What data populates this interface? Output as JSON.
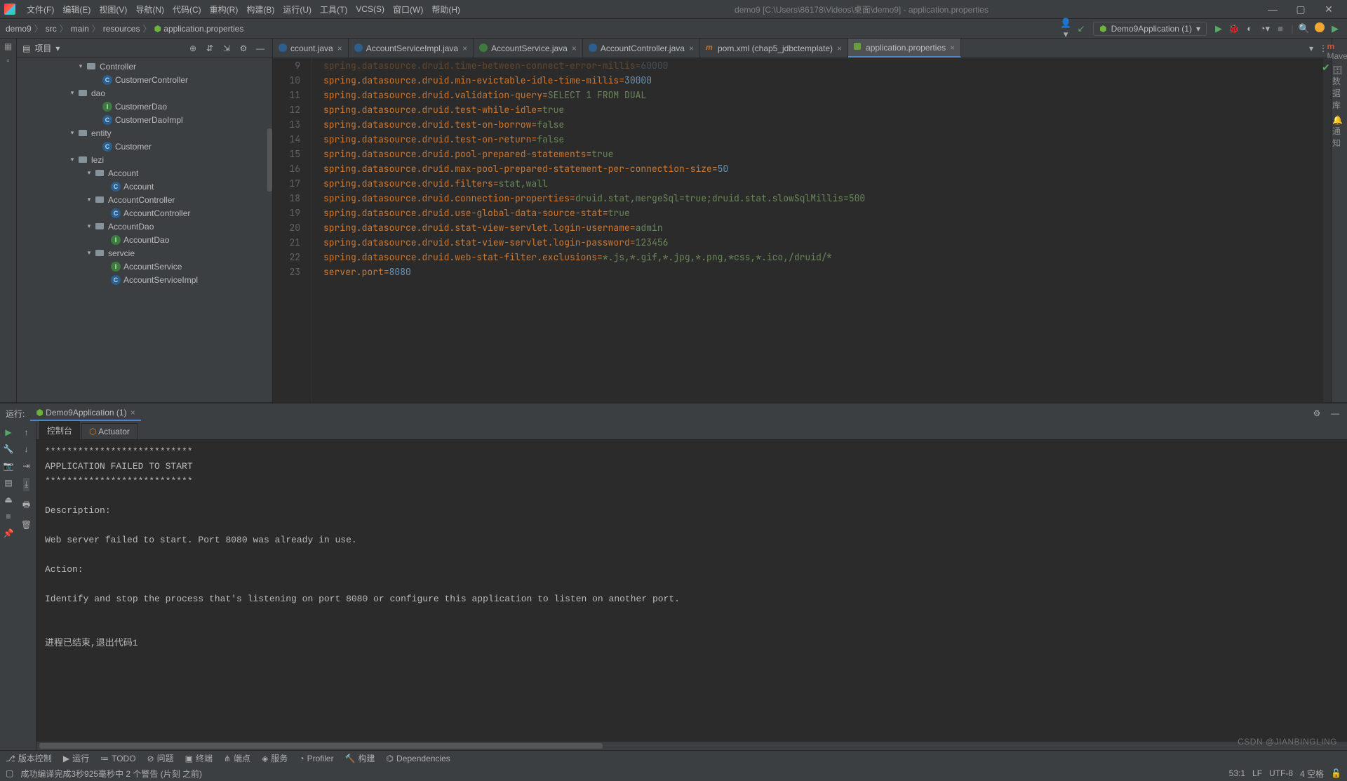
{
  "window": {
    "title": "demo9 [C:\\Users\\86178\\Videos\\桌面\\demo9] - application.properties"
  },
  "menu": {
    "file": "文件(F)",
    "edit": "编辑(E)",
    "view": "视图(V)",
    "nav": "导航(N)",
    "code": "代码(C)",
    "refactor": "重构(R)",
    "build": "构建(B)",
    "run": "运行(U)",
    "tools": "工具(T)",
    "vcs": "VCS(S)",
    "window": "窗口(W)",
    "help": "帮助(H)"
  },
  "breadcrumbs": [
    "demo9",
    "src",
    "main",
    "resources",
    "application.properties"
  ],
  "runConfig": "Demo9Application (1)",
  "projectPanel": {
    "title": "项目"
  },
  "tree": [
    {
      "indent": 7,
      "arrow": "▾",
      "icon": "pkg",
      "label": "Controller"
    },
    {
      "indent": 9,
      "arrow": "",
      "icon": "c-blue",
      "label": "CustomerController"
    },
    {
      "indent": 6,
      "arrow": "▾",
      "icon": "pkg",
      "label": "dao"
    },
    {
      "indent": 9,
      "arrow": "",
      "icon": "c-green",
      "label": "CustomerDao"
    },
    {
      "indent": 9,
      "arrow": "",
      "icon": "c-blue",
      "label": "CustomerDaoImpl"
    },
    {
      "indent": 6,
      "arrow": "▾",
      "icon": "pkg",
      "label": "entity"
    },
    {
      "indent": 9,
      "arrow": "",
      "icon": "c-blue",
      "label": "Customer"
    },
    {
      "indent": 6,
      "arrow": "▾",
      "icon": "pkg",
      "label": "lezi"
    },
    {
      "indent": 8,
      "arrow": "▾",
      "icon": "pkg",
      "label": "Account"
    },
    {
      "indent": 10,
      "arrow": "",
      "icon": "c-blue",
      "label": "Account"
    },
    {
      "indent": 8,
      "arrow": "▾",
      "icon": "pkg",
      "label": "AccountController"
    },
    {
      "indent": 10,
      "arrow": "",
      "icon": "c-blue",
      "label": "AccountController"
    },
    {
      "indent": 8,
      "arrow": "▾",
      "icon": "pkg",
      "label": "AccountDao"
    },
    {
      "indent": 10,
      "arrow": "",
      "icon": "c-green",
      "label": "AccountDao"
    },
    {
      "indent": 8,
      "arrow": "▾",
      "icon": "pkg",
      "label": "servcie"
    },
    {
      "indent": 10,
      "arrow": "",
      "icon": "c-green",
      "label": "AccountService"
    },
    {
      "indent": 10,
      "arrow": "",
      "icon": "c-blue",
      "label": "AccountServiceImpl"
    }
  ],
  "tabs": [
    {
      "icon": "java",
      "label": "ccount.java",
      "active": false,
      "partial": true
    },
    {
      "icon": "java",
      "label": "AccountServiceImpl.java",
      "active": false
    },
    {
      "icon": "iface",
      "label": "AccountService.java",
      "active": false
    },
    {
      "icon": "java",
      "label": "AccountController.java",
      "active": false
    },
    {
      "icon": "xml",
      "label": "pom.xml (chap5_jdbctemplate)",
      "active": false
    },
    {
      "icon": "props",
      "label": "application.properties",
      "active": true
    }
  ],
  "lineStart": 9,
  "code": [
    {
      "k": "spring.datasource.druid.time-between-connect-error-millis",
      "eq": "=",
      "v": "60000",
      "num": true,
      "dim": true
    },
    {
      "k": "spring.datasource.druid.min-evictable-idle-time-millis",
      "eq": "=",
      "v": "30000",
      "num": true
    },
    {
      "k": "spring.datasource.druid.validation-query",
      "eq": "=",
      "v": "SELECT 1 FROM DUAL"
    },
    {
      "k": "spring.datasource.druid.test-while-idle",
      "eq": "=",
      "v": "true"
    },
    {
      "k": "spring.datasource.druid.test-on-borrow",
      "eq": "=",
      "v": "false"
    },
    {
      "k": "spring.datasource.druid.test-on-return",
      "eq": "=",
      "v": "false"
    },
    {
      "k": "spring.datasource.druid.pool-prepared-statements",
      "eq": "=",
      "v": "true"
    },
    {
      "k": "spring.datasource.druid.max-pool-prepared-statement-per-connection-size",
      "eq": "=",
      "v": "50",
      "num": true
    },
    {
      "k": "spring.datasource.druid.filters",
      "eq": "=",
      "v": "stat,wall"
    },
    {
      "k": "spring.datasource.druid.connection-properties",
      "eq": "=",
      "v": "druid.stat,mergeSql=true;druid.stat.slowSqlMillis=500"
    },
    {
      "k": "spring.datasource.druid.use-global-data-source-stat",
      "eq": "=",
      "v": "true"
    },
    {
      "k": "spring.datasource.druid.stat-view-servlet.login-username",
      "eq": "=",
      "v": "admin"
    },
    {
      "k": "spring.datasource.druid.stat-view-servlet.login-password",
      "eq": "=",
      "v": "123456"
    },
    {
      "k": "spring.datasource.druid.web-stat-filter.exclusions",
      "eq": "=",
      "v": "*.js,*.gif,*.jpg,*.png,*css,*.ico,/druid/*"
    },
    {
      "k": "server.port",
      "eq": "=",
      "v": "8080",
      "num": true
    }
  ],
  "runPanel": {
    "title": "运行:",
    "config": "Demo9Application (1)",
    "consoleTab": "控制台",
    "actuatorTab": "Actuator"
  },
  "console": "***************************\nAPPLICATION FAILED TO START\n***************************\n\nDescription:\n\nWeb server failed to start. Port 8080 was already in use.\n\nAction:\n\nIdentify and stop the process that's listening on port 8080 or configure this application to listen on another port.\n\n\n进程已结束,退出代码1",
  "bottomTools": {
    "vcs": "版本控制",
    "run": "运行",
    "todo": "TODO",
    "problems": "问题",
    "terminal": "终端",
    "endpoints": "端点",
    "services": "服务",
    "profiler": "Profiler",
    "build": "构建",
    "deps": "Dependencies"
  },
  "status": {
    "msg": "成功编译完成3秒925毫秒中 2 个警告 (片刻 之前)",
    "pos": "53:1",
    "lf": "LF",
    "enc": "UTF-8",
    "spaces": "4 空格"
  },
  "watermark": "CSDN @JIANBINGLING",
  "rightTools": {
    "maven": "Maven",
    "db": "数据库",
    "notif": "通知"
  },
  "leftTools": {
    "struct": "结构",
    "bookmark": "书签"
  }
}
